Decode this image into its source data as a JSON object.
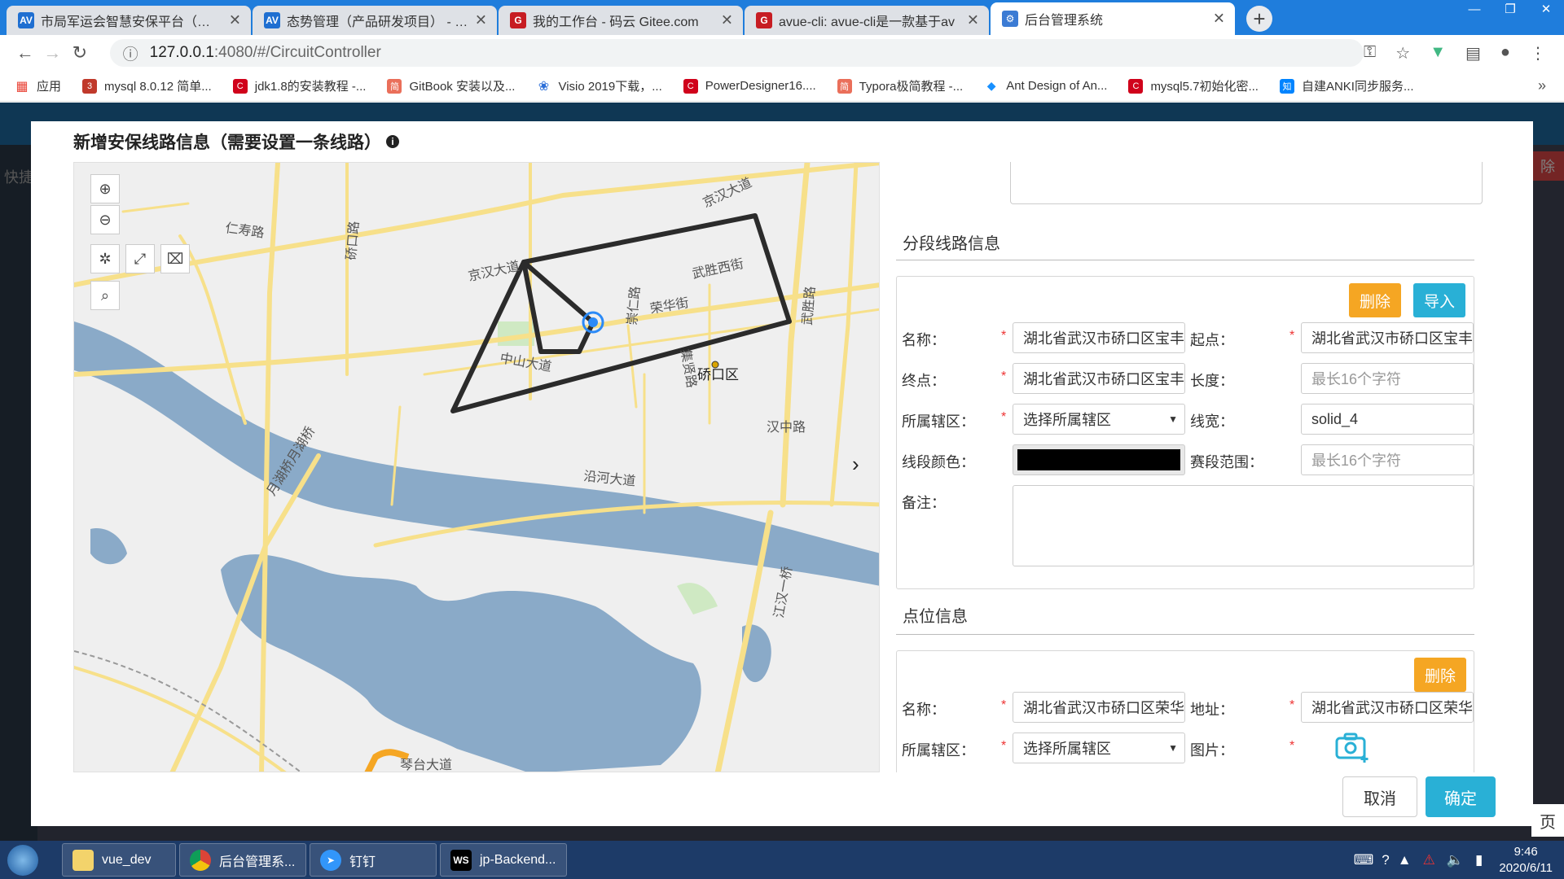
{
  "browser": {
    "tabs": [
      {
        "title": "市局军运会智慧安保平台（重点巨",
        "favicon": "AV",
        "color": "#1f6fd1"
      },
      {
        "title": "态势管理（产品研发项目） - Act",
        "favicon": "AV",
        "color": "#1f6fd1"
      },
      {
        "title": "我的工作台 - 码云 Gitee.com",
        "favicon": "G",
        "color": "#c71d23"
      },
      {
        "title": "avue-cli: avue-cli是一款基于av",
        "favicon": "G",
        "color": "#c71d23"
      },
      {
        "title": "后台管理系统",
        "favicon": "⚙",
        "color": "#3b7bd4"
      }
    ],
    "window_controls": [
      "—",
      "❐",
      "✕"
    ],
    "new_tab": "+",
    "url_host": "127.0.0.1",
    "url_path": ":4080/#/CircuitController",
    "bookmarks": [
      {
        "label": "应用",
        "icon": "apps-icon",
        "color": "#e94235"
      },
      {
        "label": "mysql 8.0.12 简单...",
        "icon": "3",
        "color": "#c0392b"
      },
      {
        "label": "jdk1.8的安装教程 -...",
        "icon": "C",
        "color": "#d0021b"
      },
      {
        "label": "GitBook 安装以及...",
        "icon": "简",
        "color": "#ea6f5a"
      },
      {
        "label": "Visio 2019下载，...",
        "icon": "❀",
        "color": "#2d6fd8"
      },
      {
        "label": "PowerDesigner16....",
        "icon": "C",
        "color": "#d0021b"
      },
      {
        "label": "Typora极简教程 -...",
        "icon": "简",
        "color": "#ea6f5a"
      },
      {
        "label": "Ant Design of An...",
        "icon": "◆",
        "color": "#1890ff"
      },
      {
        "label": "mysql5.7初始化密...",
        "icon": "C",
        "color": "#d0021b"
      },
      {
        "label": "自建ANKI同步服务...",
        "icon": "知",
        "color": "#0084ff"
      }
    ],
    "bookmarks_more": "»"
  },
  "app": {
    "sidebar_item": "快捷",
    "right_edge_button": "除",
    "right_edge_page": "页"
  },
  "modal": {
    "title": "新增安保线路信息（需要设置一条线路）",
    "map": {
      "labels": [
        {
          "text": "京汉大道",
          "kind": "road"
        },
        {
          "text": "仁寿路",
          "kind": "road"
        },
        {
          "text": "京汉大道",
          "kind": "road"
        },
        {
          "text": "武胜西街",
          "kind": "road"
        },
        {
          "text": "荣华街",
          "kind": "road"
        },
        {
          "text": "中山大道",
          "kind": "road"
        },
        {
          "text": "汉中路",
          "kind": "road"
        },
        {
          "text": "沿河大道",
          "kind": "road"
        },
        {
          "text": "月湖桥月湖桥",
          "kind": "road"
        },
        {
          "text": "硚口区",
          "kind": "district"
        },
        {
          "text": "武胜路",
          "kind": "road"
        },
        {
          "text": "硚口路",
          "kind": "road"
        },
        {
          "text": "集贤路",
          "kind": "road"
        },
        {
          "text": "崇仁路",
          "kind": "road"
        },
        {
          "text": "江汉一桥",
          "kind": "road"
        },
        {
          "text": "琴台大道",
          "kind": "road"
        }
      ]
    },
    "segment_section": {
      "title": "分段线路信息",
      "delete_label": "删除",
      "import_label": "导入",
      "name_label": "名称：",
      "name_value": "湖北省武汉市硚口区宝丰街",
      "start_label": "起点：",
      "start_value": "湖北省武汉市硚口区宝丰街",
      "end_label": "终点：",
      "end_value": "湖北省武汉市硚口区宝丰街",
      "length_label": "长度：",
      "length_placeholder": "最长16个字符",
      "district_label": "所属辖区：",
      "district_placeholder": "选择所属辖区",
      "width_label": "线宽：",
      "width_value": "solid_4",
      "color_label": "线段颜色：",
      "line_color": "#000000",
      "range_label": "赛段范围：",
      "range_placeholder": "最长16个字符",
      "remark_label": "备注："
    },
    "point_section": {
      "title": "点位信息",
      "delete_label": "删除",
      "name_label": "名称：",
      "name_value": "湖北省武汉市硚口区荣华街",
      "address_label": "地址：",
      "address_value": "湖北省武汉市硚口区荣华街",
      "district_label": "所属辖区：",
      "district_placeholder": "选择所属辖区",
      "image_label": "图片："
    },
    "cancel_label": "取消",
    "confirm_label": "确定"
  },
  "taskbar": {
    "items": [
      {
        "label": "vue_dev",
        "icon": "folder-icon"
      },
      {
        "label": "后台管理系...",
        "icon": "chrome-icon"
      },
      {
        "label": "钉钉",
        "icon": "dingtalk-icon"
      },
      {
        "label": "jp-Backend...",
        "icon": "WS"
      }
    ],
    "time": "9:46",
    "date": "2020/6/11"
  },
  "colors": {
    "accent_orange": "#f5a623",
    "accent_blue": "#29b0d6",
    "water": "#8aaac8",
    "road": "#f7e08a",
    "route": "#2b2b2b"
  }
}
